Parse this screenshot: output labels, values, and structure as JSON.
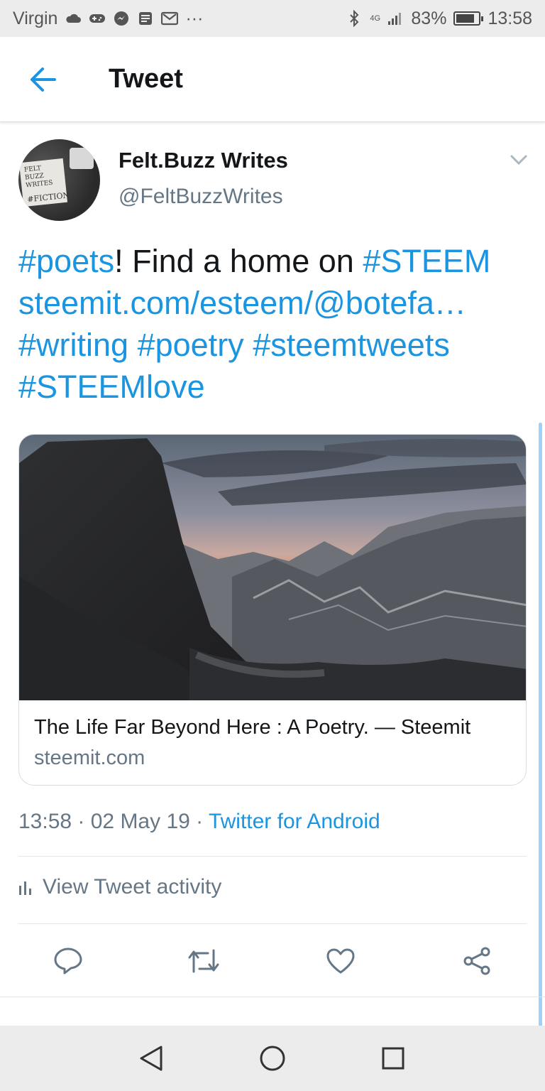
{
  "status_bar": {
    "carrier": "Virgin",
    "notification_icons": [
      "cloud-icon",
      "gamepad-icon",
      "messenger-icon",
      "news-icon",
      "gmail-icon"
    ],
    "more": "···",
    "network": "4G",
    "battery_percent": "83%",
    "battery_level": 0.83,
    "time": "13:58"
  },
  "app_bar": {
    "title": "Tweet"
  },
  "tweet": {
    "author_name": "Felt.Buzz Writes",
    "author_handle": "@FeltBuzzWrites",
    "text_lines": [
      [
        {
          "t": "#poets",
          "link": true
        },
        {
          "t": "! Find a home on ",
          "link": false
        },
        {
          "t": "#STEEM",
          "link": true
        }
      ],
      [
        {
          "t": "steemit.com/esteem/@botefa…",
          "link": true
        }
      ],
      [
        {
          "t": "#writing",
          "link": true
        },
        {
          "t": " ",
          "link": false
        },
        {
          "t": "#poetry",
          "link": true
        },
        {
          "t": " ",
          "link": false
        },
        {
          "t": "#steemtweets",
          "link": true
        }
      ],
      [
        {
          "t": "#STEEMlove",
          "link": true
        }
      ]
    ],
    "card": {
      "title": "The Life Far Beyond Here : A Poetry. — Steemit",
      "domain": "steemit.com"
    },
    "timestamp": "13:58 · 02 May 19 · ",
    "source": "Twitter for Android",
    "activity_label": "View Tweet activity"
  },
  "avatar_text": {
    "line1": "FELT BUZZ",
    "line2": "WRITES",
    "line3": "#FICTION"
  },
  "colors": {
    "link": "#1b95e0",
    "secondary_text": "#657786",
    "primary_text": "#14171a",
    "scroll_indicator": "#9fd0f5"
  },
  "actions": [
    "reply-icon",
    "retweet-icon",
    "like-icon",
    "share-icon"
  ],
  "nav": [
    "back-triangle-icon",
    "home-circle-icon",
    "recents-square-icon"
  ]
}
